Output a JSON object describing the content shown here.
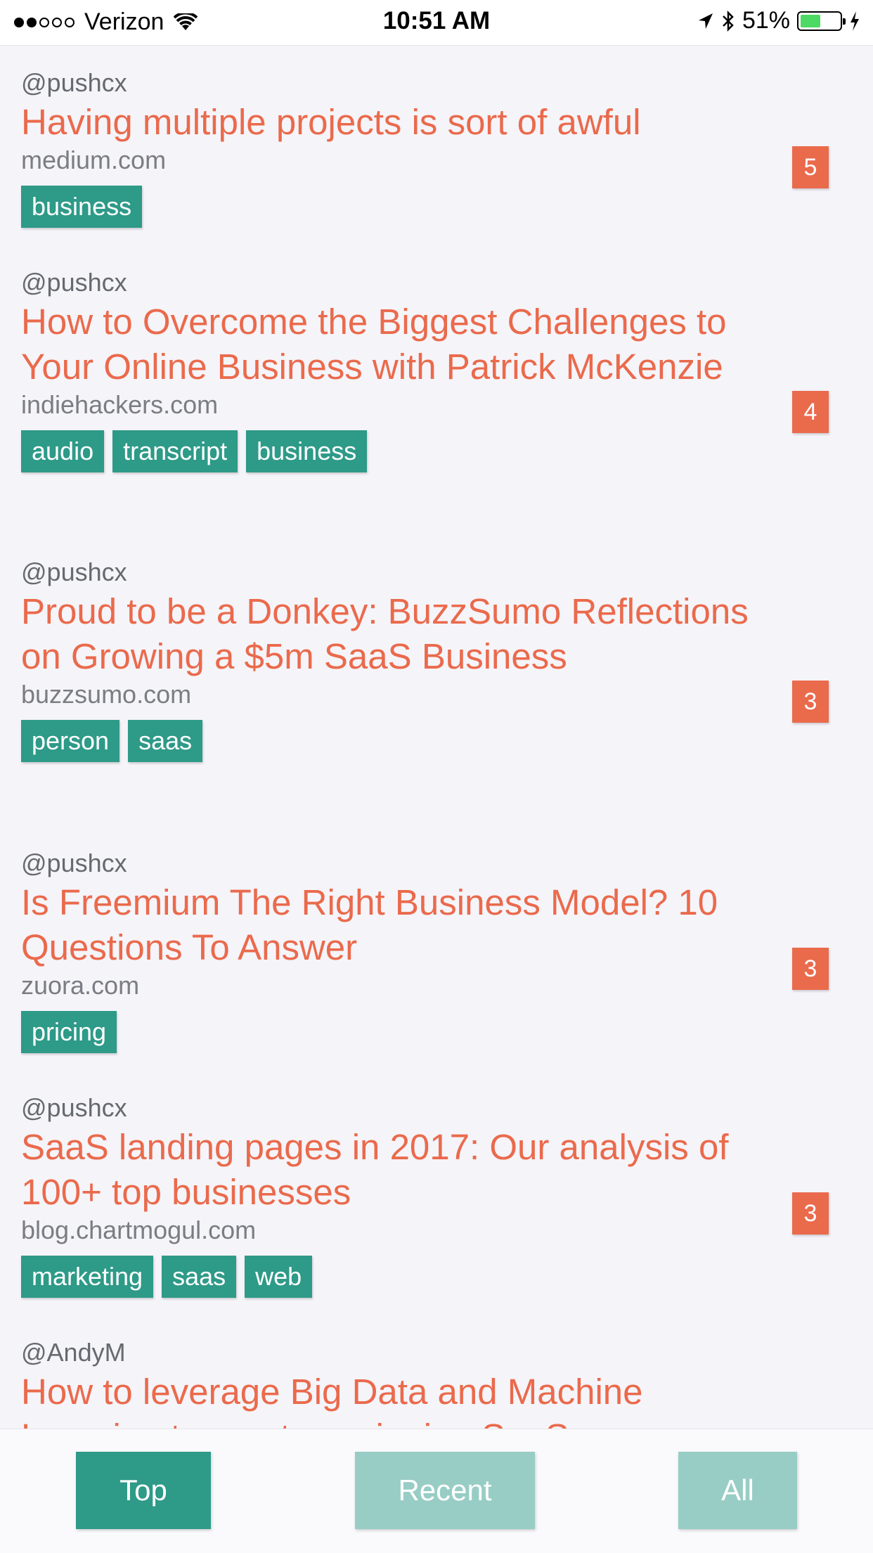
{
  "status_bar": {
    "carrier": "Verizon",
    "time": "10:51 AM",
    "battery_percent": "51%",
    "battery_level": 0.51,
    "icons": [
      "signal-dots",
      "wifi-icon",
      "location-arrow-icon",
      "bluetooth-icon",
      "battery-icon",
      "charging-bolt-icon"
    ]
  },
  "colors": {
    "accent_title": "#ea6a4c",
    "tag_bg": "#2e9a88",
    "tab_active": "#2e9a88",
    "tab_inactive": "#98cdc5",
    "background": "#f5f4f9"
  },
  "items": [
    {
      "author": "@pushcx",
      "title": "Having multiple projects is sort of awful",
      "domain": "medium.com",
      "score": "5",
      "tags": [
        "business"
      ]
    },
    {
      "author": "@pushcx",
      "title": "How to Overcome the Biggest Challenges to Your Online Business with Patrick McKenzie",
      "domain": "indiehackers.com",
      "score": "4",
      "tags": [
        "audio",
        "transcript",
        "business"
      ]
    },
    {
      "author": "@pushcx",
      "title": "Proud to be a Donkey: BuzzSumo Reflections on Growing a $5m SaaS Business",
      "domain": "buzzsumo.com",
      "score": "3",
      "tags": [
        "person",
        "saas"
      ]
    },
    {
      "author": "@pushcx",
      "title": "Is Freemium The Right Business Model? 10 Questions To Answer",
      "domain": "zuora.com",
      "score": "3",
      "tags": [
        "pricing"
      ]
    },
    {
      "author": "@pushcx",
      "title": "SaaS landing pages in 2017: Our analysis of 100+ top businesses",
      "domain": "blog.chartmogul.com",
      "score": "3",
      "tags": [
        "marketing",
        "saas",
        "web"
      ]
    },
    {
      "author": "@AndyM",
      "title": "How to leverage Big Data and Machine Learning to create a winning SaaS",
      "domain": "",
      "score": "",
      "tags": []
    }
  ],
  "tabs": [
    {
      "label": "Top",
      "active": true
    },
    {
      "label": "Recent",
      "active": false
    },
    {
      "label": "All",
      "active": false
    }
  ]
}
